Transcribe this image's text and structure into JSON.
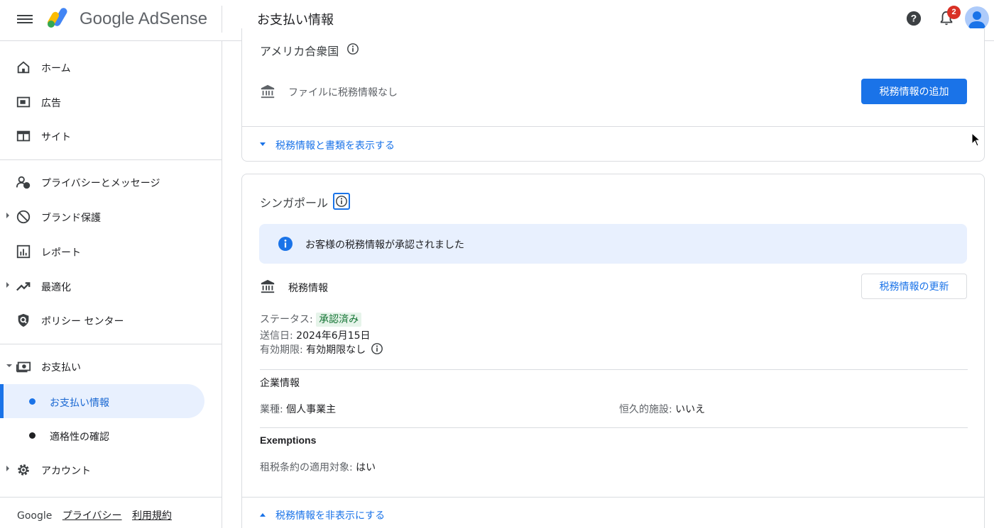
{
  "app": {
    "brand": "Google AdSense",
    "page_title": "お支払い情報",
    "notification_count": "2"
  },
  "sidebar": {
    "items": [
      {
        "label": "ホーム",
        "icon": "home-icon"
      },
      {
        "label": "広告",
        "icon": "ads-icon"
      },
      {
        "label": "サイト",
        "icon": "sites-icon"
      },
      {
        "label": "プライバシーとメッセージ",
        "icon": "privacy-icon"
      },
      {
        "label": "ブランド保護",
        "icon": "block-icon"
      },
      {
        "label": "レポート",
        "icon": "report-icon"
      },
      {
        "label": "最適化",
        "icon": "trending-icon"
      },
      {
        "label": "ポリシー センター",
        "icon": "policy-icon"
      },
      {
        "label": "お支払い",
        "icon": "payments-icon"
      },
      {
        "label": "アカウント",
        "icon": "gear-icon"
      }
    ],
    "sub_items": [
      {
        "label": "お支払い情報",
        "active": true
      },
      {
        "label": "適格性の確認",
        "active": false
      }
    ],
    "footer": {
      "google": "Google",
      "privacy": "プライバシー",
      "terms": "利用規約"
    }
  },
  "us_card": {
    "country": "アメリカ合衆国",
    "no_tax_info": "ファイルに税務情報なし",
    "add_button": "税務情報の追加",
    "show_toggle": "税務情報と書類を表示する"
  },
  "sg_card": {
    "country": "シンガポール",
    "banner": "お客様の税務情報が承認されました",
    "tax_info_label": "税務情報",
    "update_button": "税務情報の更新",
    "status_label": "ステータス:",
    "status_value": "承認済み",
    "sent_label": "送信日:",
    "sent_value": "2024年6月15日",
    "expiry_label": "有効期限:",
    "expiry_value": "有効期限なし",
    "company_title": "企業情報",
    "industry_label": "業種:",
    "industry_value": "個人事業主",
    "pe_label": "恒久的施設:",
    "pe_value": "いいえ",
    "exemptions_title": "Exemptions",
    "treaty_label": "租税条約の適用対象:",
    "treaty_value": "はい",
    "hide_toggle": "税務情報を非表示にする"
  },
  "colors": {
    "accent": "#1a73e8",
    "badge": "#d93025",
    "banner_bg": "#e8f0fe",
    "status_chip_bg": "#e6f4ea",
    "status_chip_fg": "#137333"
  }
}
